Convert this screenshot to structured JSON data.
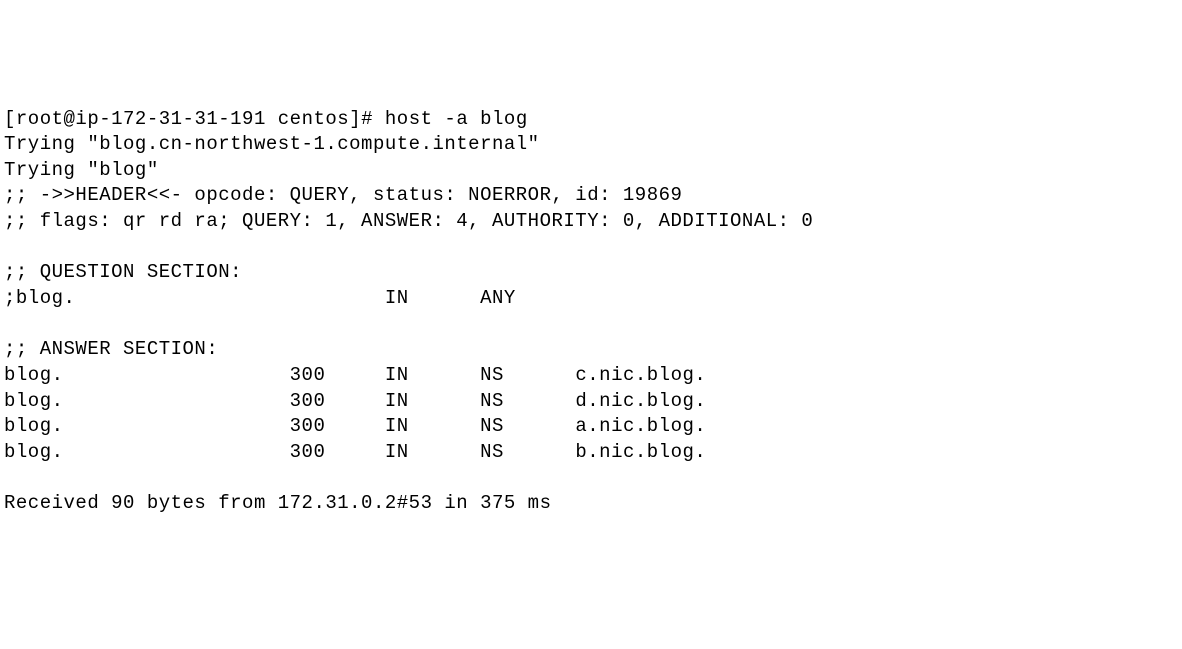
{
  "prompt": {
    "user": "root",
    "host": "ip-172-31-31-191",
    "cwd": "centos",
    "symbol": "#",
    "command": "host -a blog"
  },
  "output": {
    "trying1": "Trying \"blog.cn-northwest-1.compute.internal\"",
    "trying2": "Trying \"blog\"",
    "header_line": ";; ->>HEADER<<- opcode: QUERY, status: NOERROR, id: 19869",
    "flags_line": ";; flags: qr rd ra; QUERY: 1, ANSWER: 4, AUTHORITY: 0, ADDITIONAL: 0",
    "question_header": ";; QUESTION SECTION:",
    "question_line": ";blog.                          IN      ANY",
    "answer_header": ";; ANSWER SECTION:",
    "answers": [
      {
        "name": "blog.",
        "ttl": "300",
        "class": "IN",
        "type": "NS",
        "value": "c.nic.blog."
      },
      {
        "name": "blog.",
        "ttl": "300",
        "class": "IN",
        "type": "NS",
        "value": "d.nic.blog."
      },
      {
        "name": "blog.",
        "ttl": "300",
        "class": "IN",
        "type": "NS",
        "value": "a.nic.blog."
      },
      {
        "name": "blog.",
        "ttl": "300",
        "class": "IN",
        "type": "NS",
        "value": "b.nic.blog."
      }
    ],
    "received": "Received 90 bytes from 172.31.0.2#53 in 375 ms"
  }
}
